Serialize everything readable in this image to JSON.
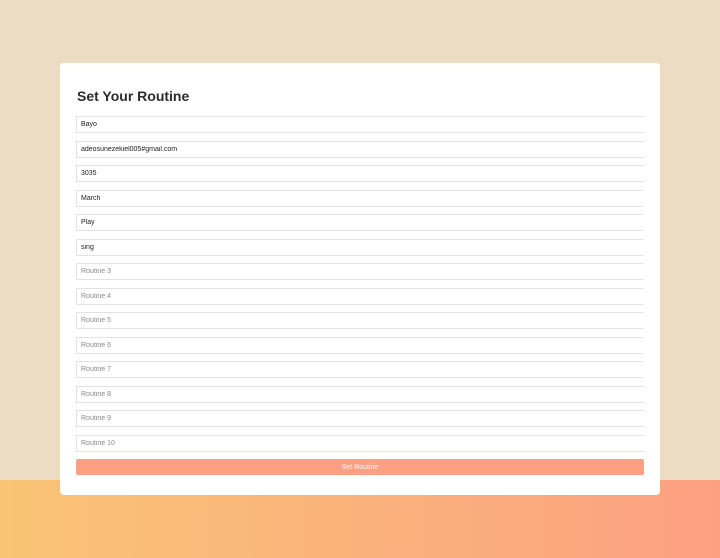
{
  "title": "Set Your Routine",
  "fields": [
    {
      "value": "Bayo",
      "placeholder": ""
    },
    {
      "value": "adeosunezekiel005#gmail.com",
      "placeholder": ""
    },
    {
      "value": "3035",
      "placeholder": ""
    },
    {
      "value": "March",
      "placeholder": ""
    },
    {
      "value": "Play",
      "placeholder": ""
    },
    {
      "value": "sing",
      "placeholder": ""
    },
    {
      "value": "",
      "placeholder": "Routine 3"
    },
    {
      "value": "",
      "placeholder": "Routine 4"
    },
    {
      "value": "",
      "placeholder": "Routine 5"
    },
    {
      "value": "",
      "placeholder": "Routine 6"
    },
    {
      "value": "",
      "placeholder": "Routine 7"
    },
    {
      "value": "",
      "placeholder": "Routine 8"
    },
    {
      "value": "",
      "placeholder": "Routine 9"
    },
    {
      "value": "",
      "placeholder": "Routine 10"
    }
  ],
  "submit_label": "Set Routine",
  "colors": {
    "background": "#ecdcc3",
    "button": "#fd9f83"
  }
}
